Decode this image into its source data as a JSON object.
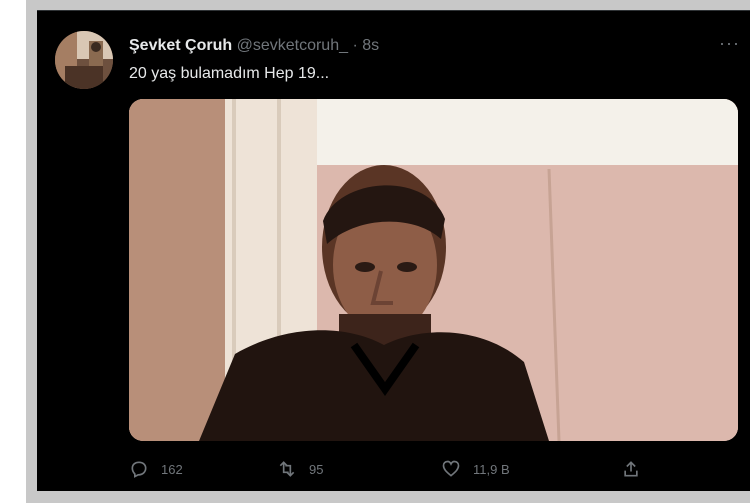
{
  "tweet": {
    "author_name": "Şevket Çoruh",
    "handle": "@sevketcoruh_",
    "separator": "·",
    "time": "8s",
    "text": "20 yaş bulamadım Hep 19...",
    "more": "···",
    "replies": "162",
    "retweets": "95",
    "likes": "11,9 B"
  },
  "icons": {
    "more": "more-icon",
    "reply": "reply-icon",
    "retweet": "retweet-icon",
    "like": "heart-icon",
    "share": "share-icon"
  },
  "colors": {
    "background": "#000000",
    "text": "#e7e9ea",
    "secondary_text": "#71767b",
    "frame": "#c8c8c8"
  }
}
